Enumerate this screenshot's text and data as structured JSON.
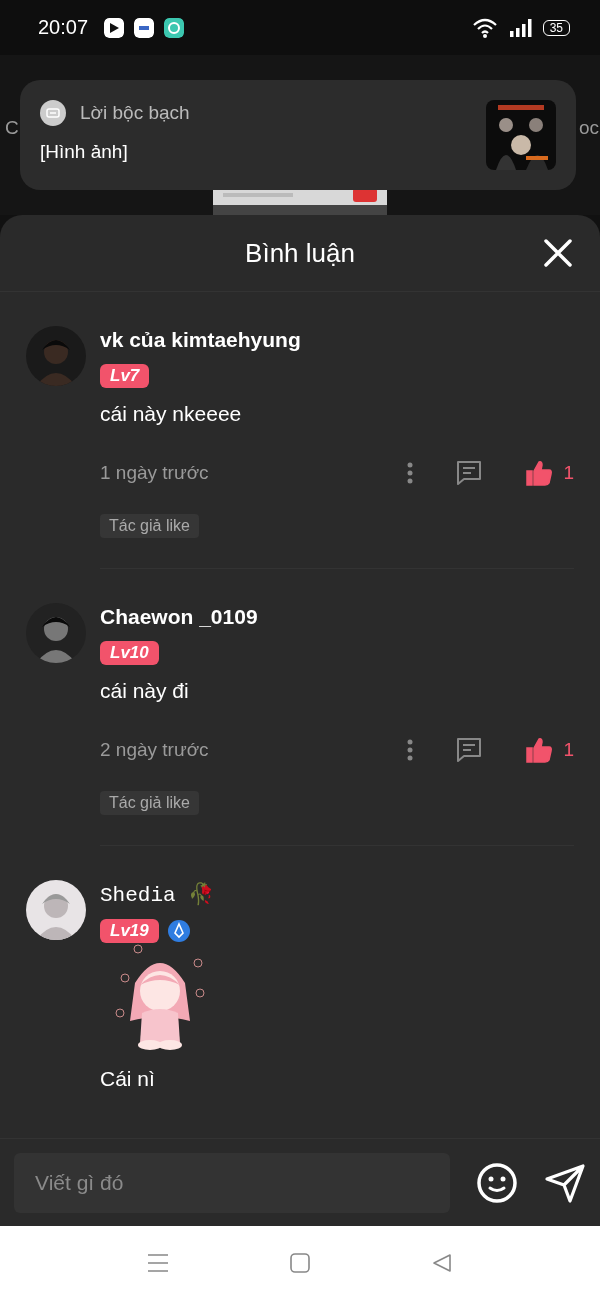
{
  "status_bar": {
    "time": "20:07",
    "battery": "35"
  },
  "background": {
    "left_fragment": "C",
    "right_fragment": "oc"
  },
  "notification": {
    "title": "Lời bộc bạch",
    "text": "[Hình ảnh]"
  },
  "sheet": {
    "title": "Bình luận"
  },
  "comments": [
    {
      "author": "vk của kimtaehyung",
      "fancy_name": false,
      "level": "Lv7",
      "verified": false,
      "sticker": false,
      "text": "cái này nkeeee",
      "time": "1 ngày trước",
      "likes": "1",
      "liked": true,
      "tag": "Tác giả like"
    },
    {
      "author": "Chaewon _0109",
      "fancy_name": false,
      "level": "Lv10",
      "verified": false,
      "sticker": false,
      "text": "cái này đi",
      "time": "2 ngày trước",
      "likes": "1",
      "liked": true,
      "tag": "Tác giả like"
    },
    {
      "author": "Shedia 🥀",
      "fancy_name": true,
      "level": "Lv19",
      "verified": true,
      "sticker": true,
      "text": "Cái nì"
    }
  ],
  "composer": {
    "placeholder": "Viết gì đó"
  }
}
